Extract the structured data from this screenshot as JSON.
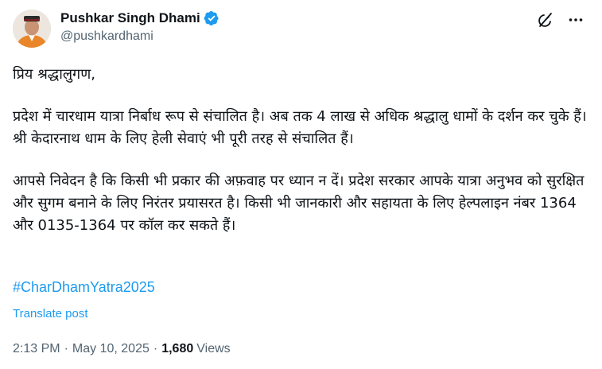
{
  "author": {
    "display_name": "Pushkar Singh Dhami",
    "handle": "@pushkardhami",
    "verified": true
  },
  "icons": {
    "verified": "verified-badge-icon",
    "grok": "grok-icon",
    "more": "more-options-icon"
  },
  "colors": {
    "text": "#0f1419",
    "secondary": "#536471",
    "link": "#1d9bf0",
    "verified": "#1d9bf0"
  },
  "tweet": {
    "paragraphs": [
      "प्रिय श्रद्धालुगण,",
      "प्रदेश में चारधाम यात्रा निर्बाध रूप से संचालित है। अब तक 4 लाख से अधिक श्रद्धालु धामों के दर्शन कर चुके हैं। श्री केदारनाथ धाम के लिए हेली सेवाएं भी पूरी तरह से संचालित हैं।",
      "आपसे निवेदन है कि किसी भी प्रकार की अफ़वाह पर ध्यान न दें। प्रदेश सरकार आपके यात्रा अनुभव को सुरक्षित और सुगम बनाने के लिए निरंतर प्रयासरत है। किसी भी जानकारी और सहायता के लिए हेल्पलाइन नंबर 1364 और 0135-1364 पर कॉल कर सकते हैं।"
    ],
    "hashtag": "#CharDhamYatra2025",
    "translate_label": "Translate post"
  },
  "meta": {
    "time": "2:13 PM",
    "separator": "·",
    "date": "May 10, 2025",
    "views_count": "1,680",
    "views_label": "Views"
  }
}
